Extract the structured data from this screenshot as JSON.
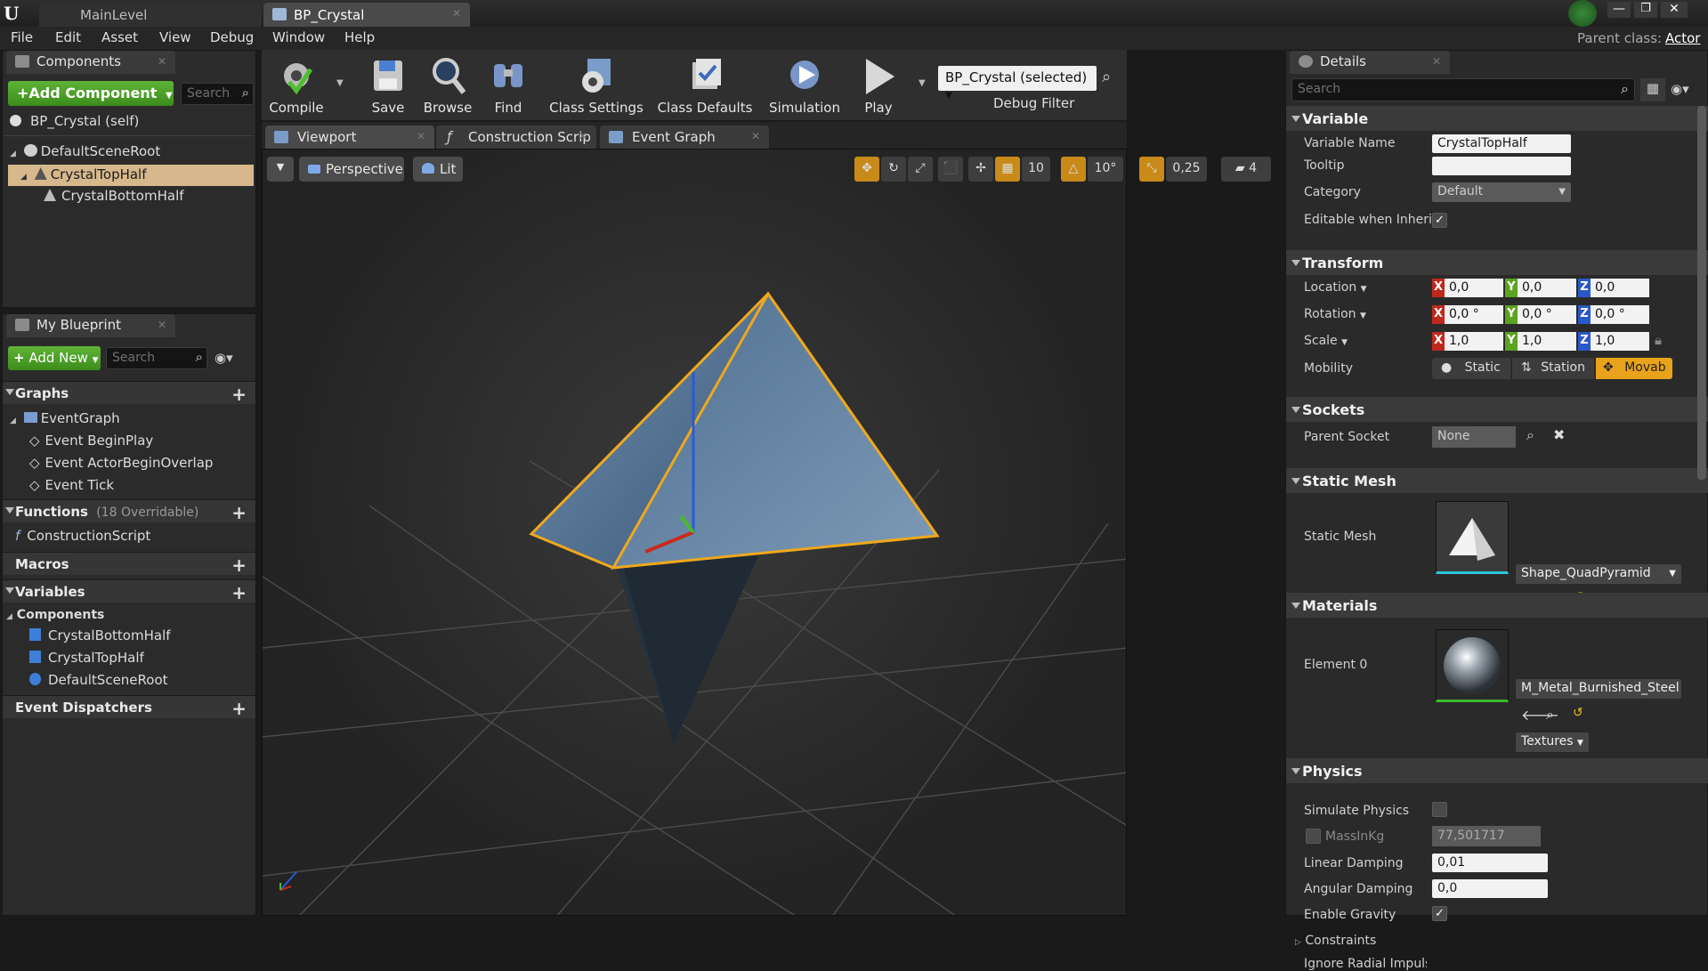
{
  "titlebar": {
    "tabs": [
      {
        "label": "MainLevel"
      },
      {
        "label": "BP_Crystal"
      }
    ],
    "parent_class_label": "Parent class:",
    "parent_class_value": "Actor"
  },
  "menu": {
    "items": [
      "File",
      "Edit",
      "Asset",
      "View",
      "Debug",
      "Window",
      "Help"
    ]
  },
  "components_panel": {
    "tab": "Components",
    "add_component": "+Add Component",
    "search_placeholder": "Search",
    "self_item": "BP_Crystal (self)",
    "tree": [
      "DefaultSceneRoot",
      "CrystalTopHalf",
      "CrystalBottomHalf"
    ]
  },
  "my_blueprint": {
    "tab": "My Blueprint",
    "add_new": "Add New",
    "search_placeholder": "Search",
    "graphs_header": "Graphs",
    "event_graph": "EventGraph",
    "events": [
      "Event BeginPlay",
      "Event ActorBeginOverlap",
      "Event Tick"
    ],
    "functions_header": "Functions",
    "functions_count": "(18 Overridable)",
    "construction_script": "ConstructionScript",
    "macros_header": "Macros",
    "variables_header": "Variables",
    "components_subheader": "Components",
    "component_vars": [
      "CrystalBottomHalf",
      "CrystalTopHalf",
      "DefaultSceneRoot"
    ],
    "dispatchers_header": "Event Dispatchers"
  },
  "toolbar": {
    "compile": "Compile",
    "save": "Save",
    "browse": "Browse",
    "find": "Find",
    "class_settings": "Class Settings",
    "class_defaults": "Class Defaults",
    "simulation": "Simulation",
    "play": "Play",
    "debug_select": "BP_Crystal (selected)",
    "debug_filter": "Debug Filter"
  },
  "editor_tabs": [
    {
      "label": "Viewport"
    },
    {
      "label": "Construction Scrip"
    },
    {
      "label": "Event Graph"
    }
  ],
  "viewport": {
    "perspective": "Perspective",
    "lit": "Lit",
    "grid_snap": "10",
    "rot_snap": "10°",
    "scale_snap": "0,25",
    "cam_speed": "4"
  },
  "details": {
    "tab": "Details",
    "search_placeholder": "Search",
    "variable": {
      "header": "Variable",
      "name_label": "Variable Name",
      "name_value": "CrystalTopHalf",
      "tooltip_label": "Tooltip",
      "tooltip_value": "",
      "category_label": "Category",
      "category_value": "Default",
      "editable_label": "Editable when Inherit"
    },
    "transform": {
      "header": "Transform",
      "location_label": "Location",
      "rotation_label": "Rotation",
      "scale_label": "Scale",
      "location": [
        "0,0",
        "0,0",
        "0,0"
      ],
      "rotation": [
        "0,0 °",
        "0,0 °",
        "0,0 °"
      ],
      "scale": [
        "1,0",
        "1,0",
        "1,0"
      ],
      "axis_labels": [
        "X",
        "Y",
        "Z"
      ],
      "mobility_label": "Mobility",
      "mobility_options": [
        "Static",
        "Station",
        "Movab"
      ]
    },
    "sockets": {
      "header": "Sockets",
      "parent_label": "Parent Socket",
      "parent_value": "None"
    },
    "static_mesh": {
      "header": "Static Mesh",
      "label": "Static Mesh",
      "value": "Shape_QuadPyramid"
    },
    "materials": {
      "header": "Materials",
      "label": "Element 0",
      "value": "M_Metal_Burnished_Steel",
      "textures": "Textures"
    },
    "physics": {
      "header": "Physics",
      "simulate_label": "Simulate Physics",
      "mass_label": "MassInKg",
      "mass_value": "77,501717",
      "linear_label": "Linear Damping",
      "linear_value": "0,01",
      "angular_label": "Angular Damping",
      "angular_value": "0,0",
      "gravity_label": "Enable Gravity",
      "constraints_label": "Constraints",
      "radial_label": "Ignore Radial Impulse"
    }
  },
  "colors": {
    "accent_orange": "#e8a21c",
    "add_green": "#4ea22a",
    "selection": "#d7b88c"
  }
}
